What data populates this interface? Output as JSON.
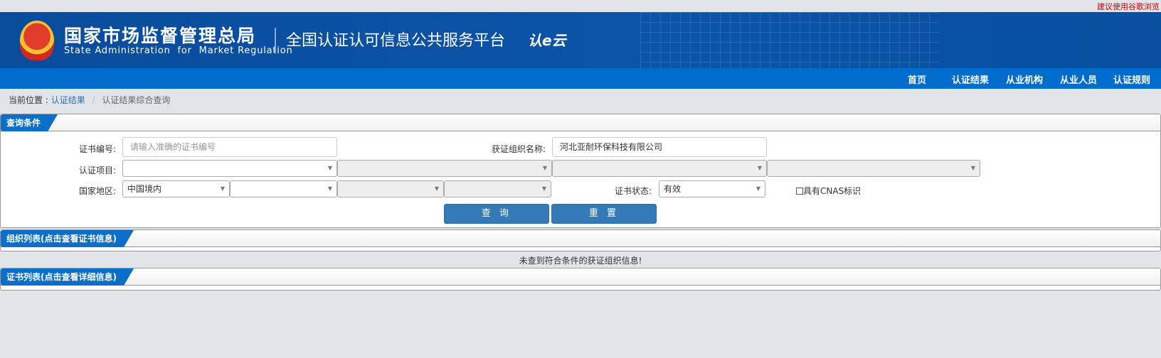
{
  "topbar": {
    "browser_tip": "建议使用谷歌浏览"
  },
  "header": {
    "org_cn": "国家市场监督管理总局",
    "org_en": "State Administration  for  Market Regulation",
    "platform": "全国认证认可信息公共服务平台",
    "logo_text": "认e云"
  },
  "nav": {
    "items": [
      "首页",
      "认证结果",
      "从业机构",
      "从业人员",
      "认证规则"
    ]
  },
  "breadcrumb": {
    "prefix": "当前位置 :",
    "link": "认证结果",
    "separator": "/",
    "current": "认证结果综合查询"
  },
  "query": {
    "title": "查询条件",
    "cert_no_label": "证书编号:",
    "cert_no_placeholder": "请输入准确的证书编号",
    "cert_no_value": "",
    "org_name_label": "获证组织名称:",
    "org_name_value": "河北亚耐环保科技有限公司",
    "project_label": "认证项目:",
    "project_values": [
      "",
      "",
      "",
      ""
    ],
    "region_label": "国家地区:",
    "region_values": [
      "中国境内",
      "",
      "",
      ""
    ],
    "status_label": "证书状态:",
    "status_value": "有效",
    "cnas_label": "具有CNAS标识",
    "cnas_checked": false,
    "search_button": "查 询",
    "reset_button": "重 置"
  },
  "org_list": {
    "title": "组织列表(点击查看证书信息)",
    "empty_message": "未查到符合条件的获证组织信息!"
  },
  "cert_list": {
    "title": "证书列表(点击查看详细信息)"
  },
  "colors": {
    "banner": "#0a4fa0",
    "nav": "#006dce",
    "button": "#337ab7",
    "tip": "#cc0000"
  }
}
